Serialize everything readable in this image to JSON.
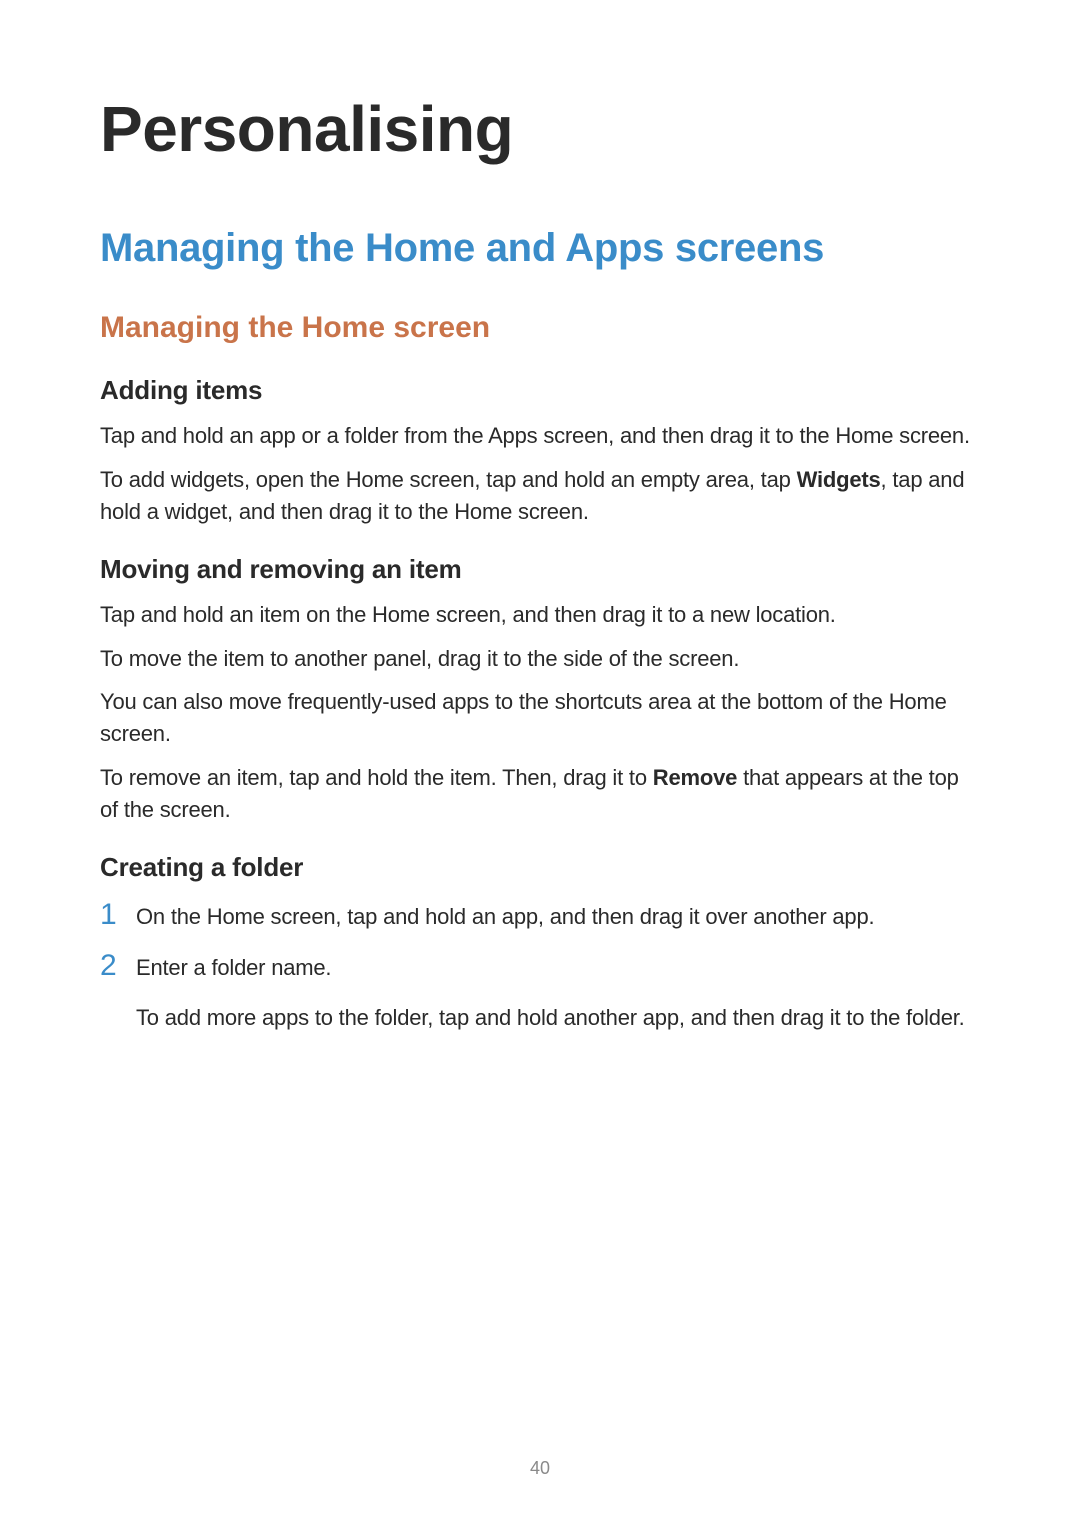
{
  "chapterTitle": "Personalising",
  "sectionTitle": "Managing the Home and Apps screens",
  "subsectionTitle": "Managing the Home screen",
  "blocks": {
    "addingItems": {
      "title": "Adding items",
      "p1": "Tap and hold an app or a folder from the Apps screen, and then drag it to the Home screen.",
      "p2a": "To add widgets, open the Home screen, tap and hold an empty area, tap ",
      "p2bold": "Widgets",
      "p2b": ", tap and hold a widget, and then drag it to the Home screen."
    },
    "movingRemoving": {
      "title": "Moving and removing an item",
      "p1": "Tap and hold an item on the Home screen, and then drag it to a new location.",
      "p2": "To move the item to another panel, drag it to the side of the screen.",
      "p3": "You can also move frequently-used apps to the shortcuts area at the bottom of the Home screen.",
      "p4a": "To remove an item, tap and hold the item. Then, drag it to ",
      "p4bold": "Remove",
      "p4b": " that appears at the top of the screen."
    },
    "creatingFolder": {
      "title": "Creating a folder",
      "items": {
        "n1": "1",
        "t1": "On the Home screen, tap and hold an app, and then drag it over another app.",
        "n2": "2",
        "t2": "Enter a folder name.",
        "t2sub": "To add more apps to the folder, tap and hold another app, and then drag it to the folder."
      }
    }
  },
  "pageNumber": "40"
}
